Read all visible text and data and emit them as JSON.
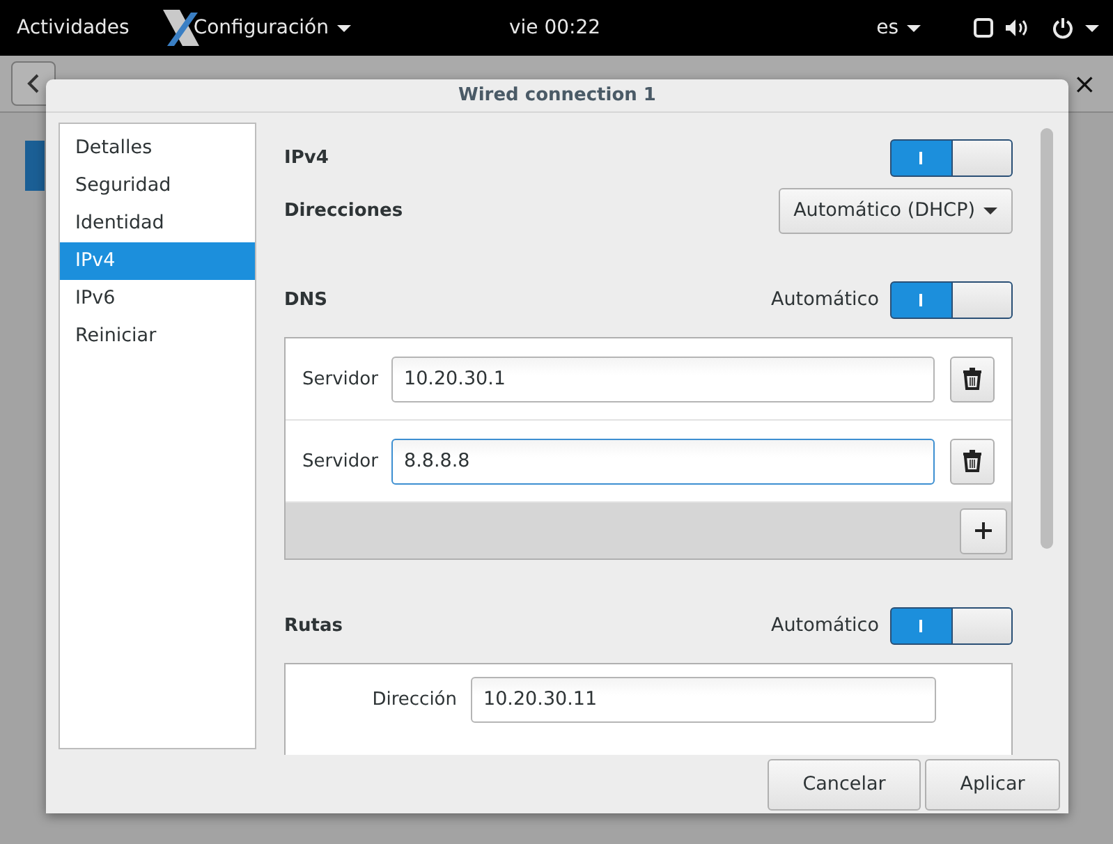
{
  "top_bar": {
    "activities": "Actividades",
    "app_menu": "Configuración",
    "clock": "vie 00:22",
    "language": "es"
  },
  "background_window": {
    "close_label": "×"
  },
  "dialog": {
    "title": "Wired connection 1",
    "sidebar": [
      {
        "label": "Detalles",
        "selected": false
      },
      {
        "label": "Seguridad",
        "selected": false
      },
      {
        "label": "Identidad",
        "selected": false
      },
      {
        "label": "IPv4",
        "selected": true
      },
      {
        "label": "IPv6",
        "selected": false
      },
      {
        "label": "Reiniciar",
        "selected": false
      }
    ],
    "ipv4": {
      "label": "IPv4",
      "on": true
    },
    "addresses": {
      "label": "Direcciones",
      "method": "Automático (DHCP)"
    },
    "dns": {
      "label": "DNS",
      "auto_label": "Automático",
      "auto": true,
      "servers": [
        {
          "label": "Servidor",
          "value": "10.20.30.1",
          "focused": false
        },
        {
          "label": "Servidor",
          "value": "8.8.8.8",
          "focused": true
        }
      ]
    },
    "routes": {
      "label": "Rutas",
      "auto_label": "Automático",
      "auto": true,
      "entries": [
        {
          "label": "Dirección",
          "value": "10.20.30.11"
        }
      ]
    },
    "buttons": [
      "Cancelar",
      "Aplicar"
    ]
  }
}
